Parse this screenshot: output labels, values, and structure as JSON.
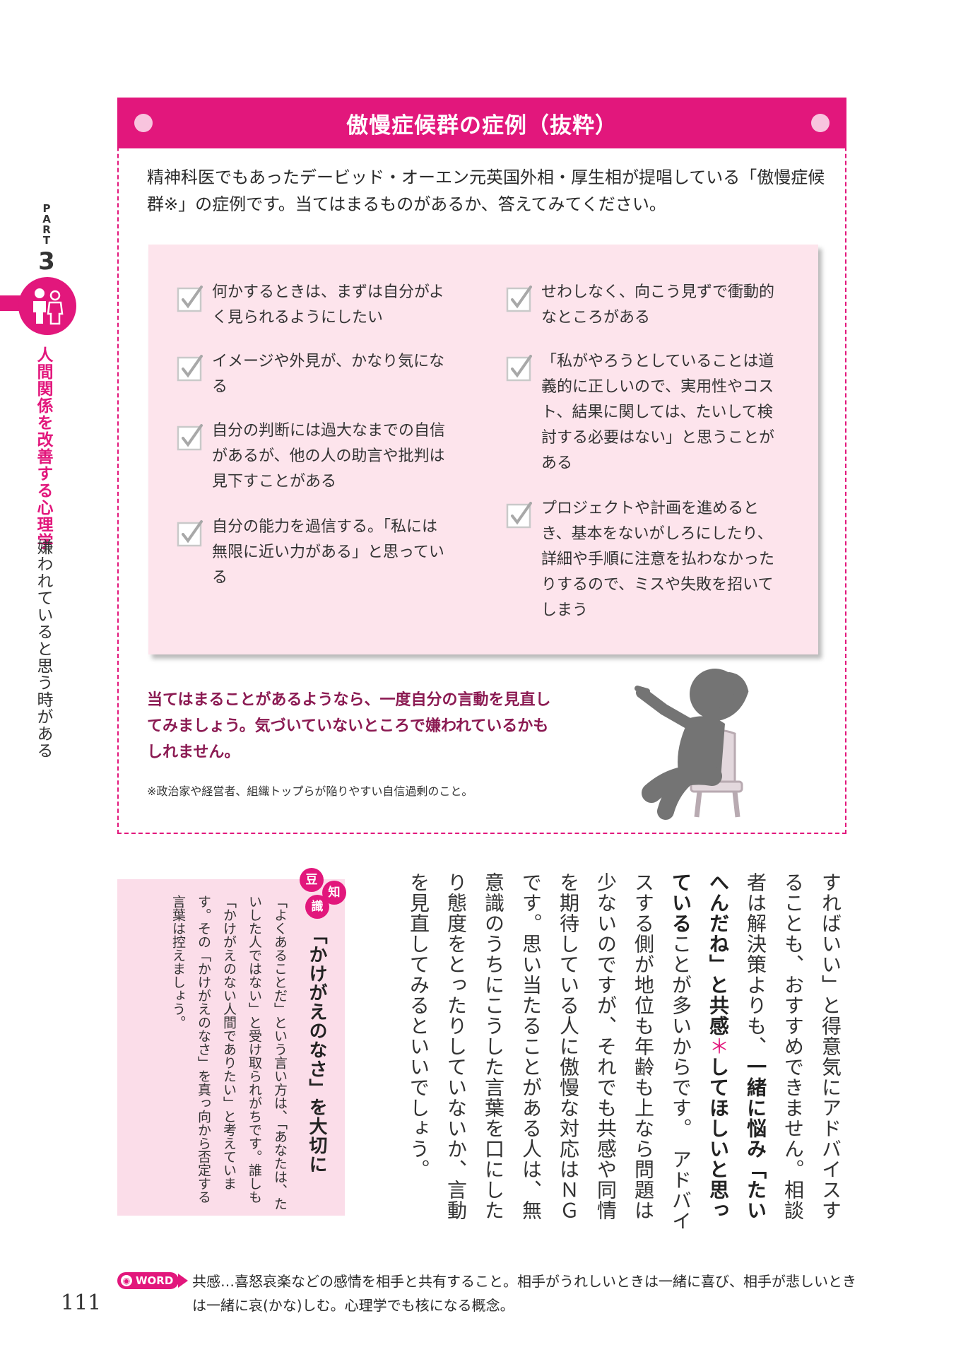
{
  "side_index": {
    "part_label_letters": [
      "P",
      "A",
      "R",
      "T"
    ],
    "part_number": "3",
    "part_title": "人間関係を改善する心理学",
    "part_subtitle": "嫌われていると思う時がある",
    "icon": "people-icon"
  },
  "box": {
    "title": "傲慢症候群の症例（抜粋）",
    "intro": "精神科医でもあったデービッド・オーエン元英国外相・厚生相が提唱している「傲慢症候群※」の症例です。当てはまるものがあるか、答えてみてください。",
    "checklist_left": [
      "何かするときは、まずは自分がよく見られるようにしたい",
      "イメージや外見が、かなり気になる",
      "自分の判断には過大なまでの自信があるが、他の人の助言や批判は見下すことがある",
      "自分の能力を過信する。「私には無限に近い力がある」と思っている"
    ],
    "checklist_right": [
      "せわしなく、向こう見ずで衝動的なところがある",
      "「私がやろうとしていることは道義的に正しいので、実用性やコスト、結果に関しては、たいして検討する必要はない」と思うことがある",
      "プロジェクトや計画を進めるとき、基本をないがしろにしたり、詳細や手順に注意を払わなかったりするので、ミスや失敗を招いてしまう"
    ],
    "summary": "当てはまることがあるようなら、一度自分の言動を見直してみましょう。気づいていないところで嫌われているかもしれません。",
    "footnote": "※政治家や経営者、組織トップらが陥りやすい自信過剰のこと。",
    "checkbox_icon": "checkmark-icon",
    "figure_icon": "arrogant-person-icon"
  },
  "mame": {
    "badge_chars": [
      "豆",
      "知",
      "識"
    ],
    "title": "「かけがえのなさ」を大切に",
    "body": "「よくあることだ」という言い方は、「あなたは、たいした人ではない」と受け取られがちです。誰しも「かけがえのない人間でありたい」と考えています。その「かけがえのなさ」を真っ向から否定する言葉は控えましょう。"
  },
  "main_text": {
    "part1": "すればいい」と得意気にアドバイスすることも、おすすめできません。相談者は解決策よりも、",
    "bold1": "一緒に悩み「たいへんだね」と共感",
    "asterisk": "＊",
    "bold2": "してほしいと思っている",
    "part2": "ことが多いからです。　アドバイスする側が地位も年齢も上なら問題は少ないのですが、それでも共感や同情を期待している人に傲慢な対応はＮＧです。思い当たることがある人は、無意識のうちにこうした言葉を口にしたり態度をとったりしていないか、言動を見直してみるといいでしょう。"
  },
  "footer": {
    "word_label": "WORD",
    "word_text": "共感…喜怒哀楽などの感情を相手と共有すること。相手がうれしいときは一緒に喜び、相手が悲しいときは一緒に哀(かな)しむ。心理学でも核になる概念。",
    "page_number": "111"
  },
  "colors": {
    "accent": "#e2177c",
    "panel_bg": "#fde4ec",
    "summary_text": "#8b1a52",
    "mame_bg": "#fbdde9"
  }
}
